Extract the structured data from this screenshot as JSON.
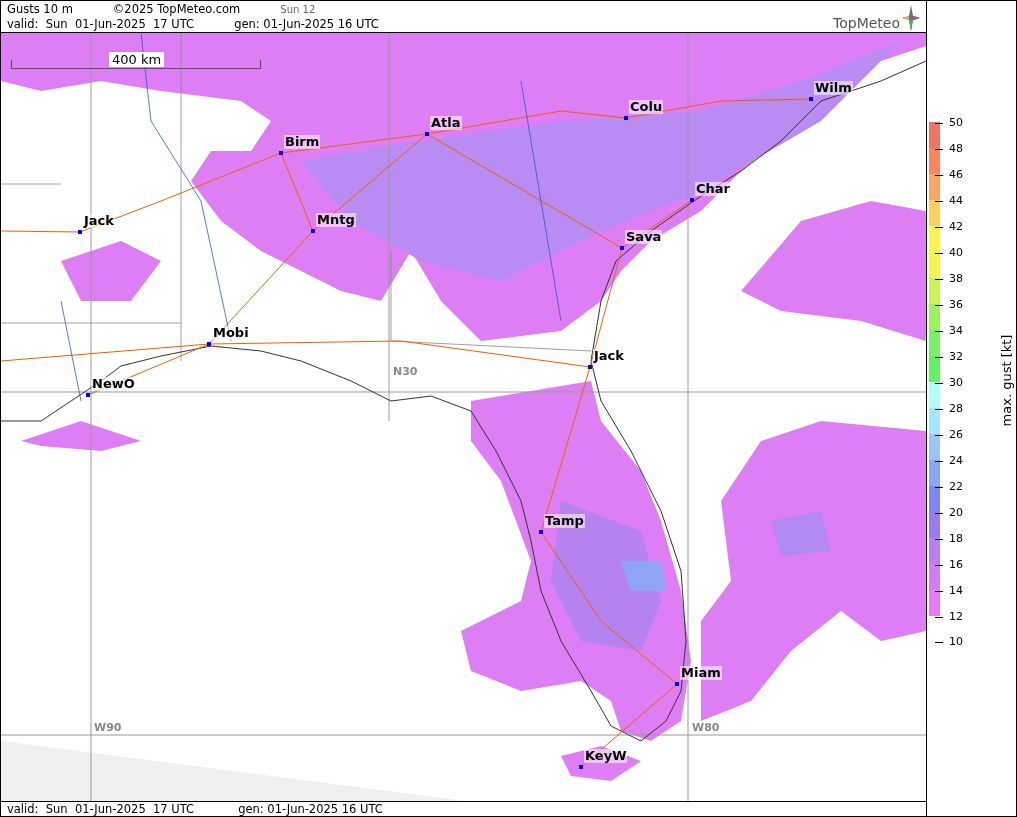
{
  "header": {
    "title": "Gusts 10 m",
    "copyright": "©2025 TopMeteo.com",
    "run": "Sun 12",
    "valid": "valid:  Sun  01-Jun-2025  17 UTC",
    "generated": "gen: 01-Jun-2025 16 UTC",
    "logo": "TopMeteo"
  },
  "map": {
    "scale": "400 km",
    "grid_labels": [
      "N30",
      "W90",
      "W80"
    ],
    "cities": [
      "Wilm",
      "Colu",
      "Atla",
      "Birm",
      "Char",
      "Jack",
      "Mntg",
      "Sava",
      "Mobi",
      "Jack",
      "NewO",
      "Tamp",
      "Miam",
      "KeyW"
    ]
  },
  "legend": {
    "title": "max. gust [kt]",
    "ticks": [
      "50",
      "48",
      "46",
      "44",
      "42",
      "40",
      "38",
      "36",
      "34",
      "32",
      "30",
      "28",
      "26",
      "24",
      "22",
      "20",
      "18",
      "16",
      "14",
      "12",
      "10"
    ],
    "bands": [
      {
        "color": "#ee7464"
      },
      {
        "color": "#f78661"
      },
      {
        "color": "#f9a565"
      },
      {
        "color": "#fbcf62"
      },
      {
        "color": "#fbf34e"
      },
      {
        "color": "#f2f550"
      },
      {
        "color": "#c8f45a"
      },
      {
        "color": "#98f262"
      },
      {
        "color": "#7af06a"
      },
      {
        "color": "#66f068"
      },
      {
        "color": "#b6fbfd"
      },
      {
        "color": "#a8e4fa"
      },
      {
        "color": "#9cc4f7"
      },
      {
        "color": "#8aa6f5"
      },
      {
        "color": "#7f86f2"
      },
      {
        "color": "#9a7cf0"
      },
      {
        "color": "#b77ff0"
      },
      {
        "color": "#d07ef2"
      },
      {
        "color": "#e87af5"
      }
    ]
  },
  "footer": {
    "valid": "valid:  Sun  01-Jun-2025  17 UTC",
    "generated": "gen: 01-Jun-2025 16 UTC"
  }
}
